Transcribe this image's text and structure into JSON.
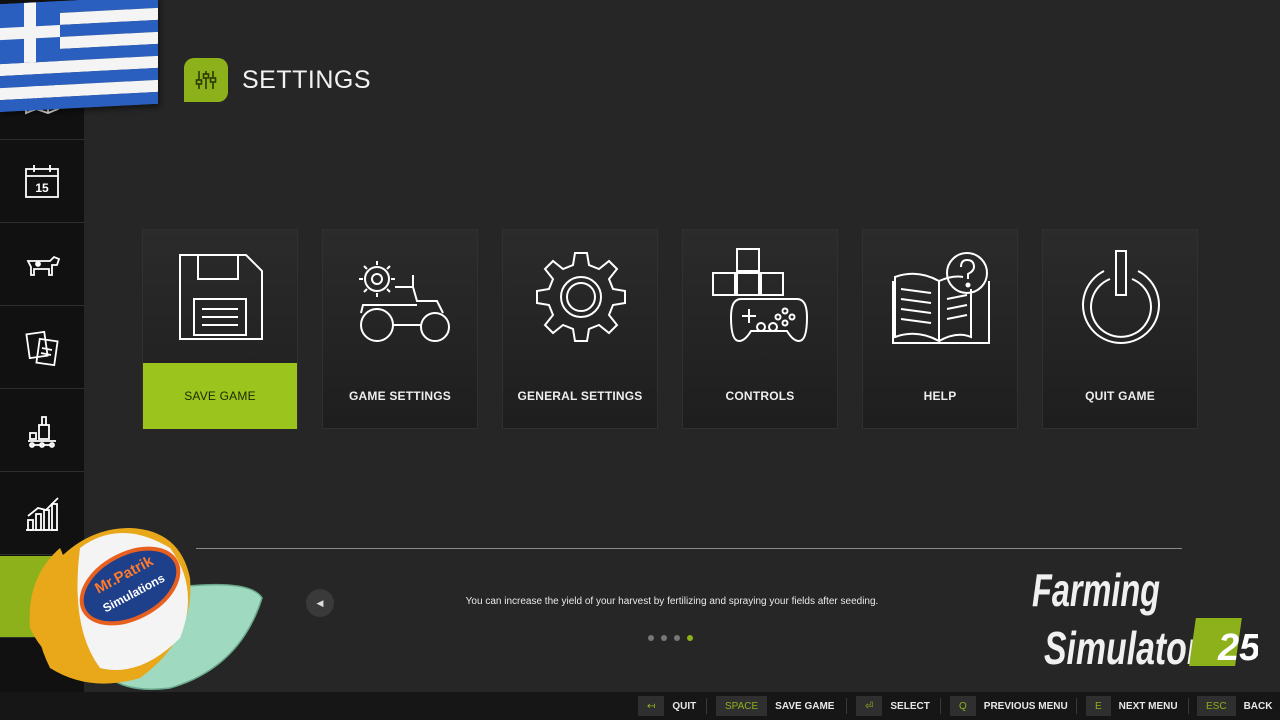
{
  "header": {
    "title": "SETTINGS",
    "icon": "settings-sliders-icon"
  },
  "sidebar": {
    "items": [
      {
        "name": "map",
        "icon": "map-icon"
      },
      {
        "name": "calendar",
        "icon": "calendar-icon",
        "text": "15"
      },
      {
        "name": "animals",
        "icon": "cow-icon"
      },
      {
        "name": "contracts",
        "icon": "contracts-icon"
      },
      {
        "name": "production",
        "icon": "production-icon"
      },
      {
        "name": "statistics",
        "icon": "bar-chart-icon"
      },
      {
        "name": "settings",
        "icon": "settings-icon",
        "active": true
      }
    ]
  },
  "tiles": [
    {
      "label": "SAVE GAME",
      "icon": "floppy-disk-icon",
      "active": true
    },
    {
      "label": "GAME SETTINGS",
      "icon": "tractor-gear-icon"
    },
    {
      "label": "GENERAL SETTINGS",
      "icon": "gear-icon"
    },
    {
      "label": "CONTROLS",
      "icon": "gamepad-keys-icon"
    },
    {
      "label": "HELP",
      "icon": "book-question-icon"
    },
    {
      "label": "QUIT GAME",
      "icon": "power-icon"
    }
  ],
  "tip": {
    "text": "You can increase the yield of your harvest by fertilizing and spraying your fields after seeding.",
    "page_count": 4,
    "active_page": 4
  },
  "footer": [
    {
      "key": "↤",
      "label": "QUIT"
    },
    {
      "key": "SPACE",
      "label": "SAVE GAME"
    },
    {
      "key": "⏎",
      "label": "SELECT"
    },
    {
      "key": "Q",
      "label": "PREVIOUS MENU"
    },
    {
      "key": "E",
      "label": "NEXT MENU"
    },
    {
      "key": "ESC",
      "label": "BACK"
    }
  ],
  "logo": {
    "line1": "Farming",
    "line2": "Simulator",
    "number": "25"
  },
  "overlay": {
    "cap_text_1": "Mr.Patrik",
    "cap_text_2": "Simulations"
  },
  "colors": {
    "accent": "#9bc41c",
    "background": "#262626",
    "sidebar": "#111111"
  }
}
